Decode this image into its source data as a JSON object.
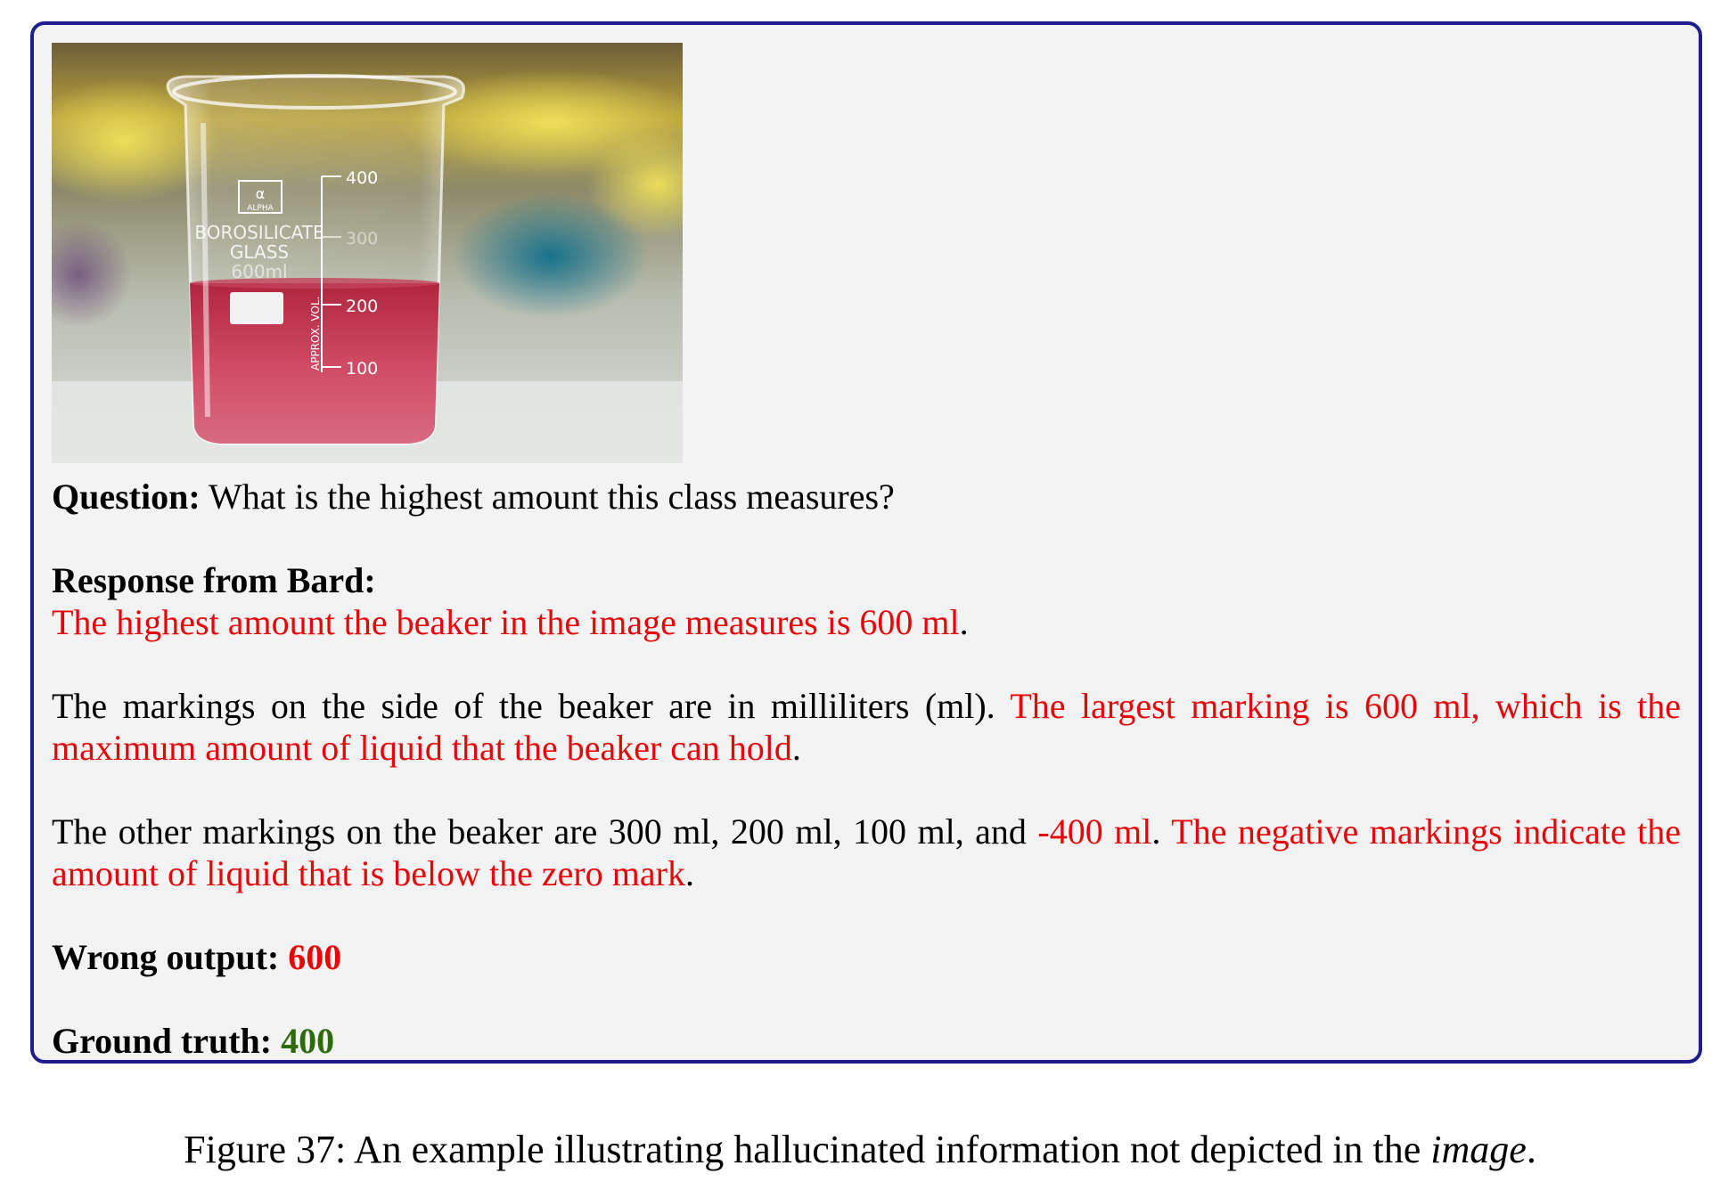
{
  "photo": {
    "beaker_logo_symbol": "α",
    "beaker_logo_text": "ALPHA",
    "beaker_material_1": "BOROSILICATE",
    "beaker_material_2": "GLASS",
    "beaker_capacity": "600ml",
    "scale_label": "APPROX. VOL.",
    "marks": [
      "400",
      "300",
      "200",
      "100"
    ]
  },
  "question": {
    "label": "Question:",
    "text": " What is the highest amount this class measures?"
  },
  "response": {
    "label": "Response from Bard:",
    "p1_red": "The highest amount the beaker in the image measures is 600 ml",
    "p1_end": ".",
    "p2_black": "The markings on the side of the beaker are in milliliters (ml).  ",
    "p2_red": "The largest marking is 600 ml, which is the maximum amount of liquid that the beaker can hold",
    "p2_end": ".",
    "p3_black": "The other markings on the beaker are 300 ml, 200 ml, 100 ml, and ",
    "p3_red1": "-400 ml",
    "p3_mid": ".  ",
    "p3_red2": "The negative markings indicate the amount of liquid that is below the zero mark",
    "p3_end": "."
  },
  "wrong": {
    "label": "Wrong output:",
    "value": "600"
  },
  "truth": {
    "label": "Ground truth:",
    "value": "400"
  },
  "caption": {
    "prefix": "Figure 37:  An example illustrating hallucinated information not depicted in the ",
    "italic": "image",
    "suffix": "."
  },
  "colors": {
    "border": "#1f1c8c",
    "panel": "#f3f3f3",
    "error_red": "#e8050a",
    "truth_green": "#2e6b0c"
  }
}
